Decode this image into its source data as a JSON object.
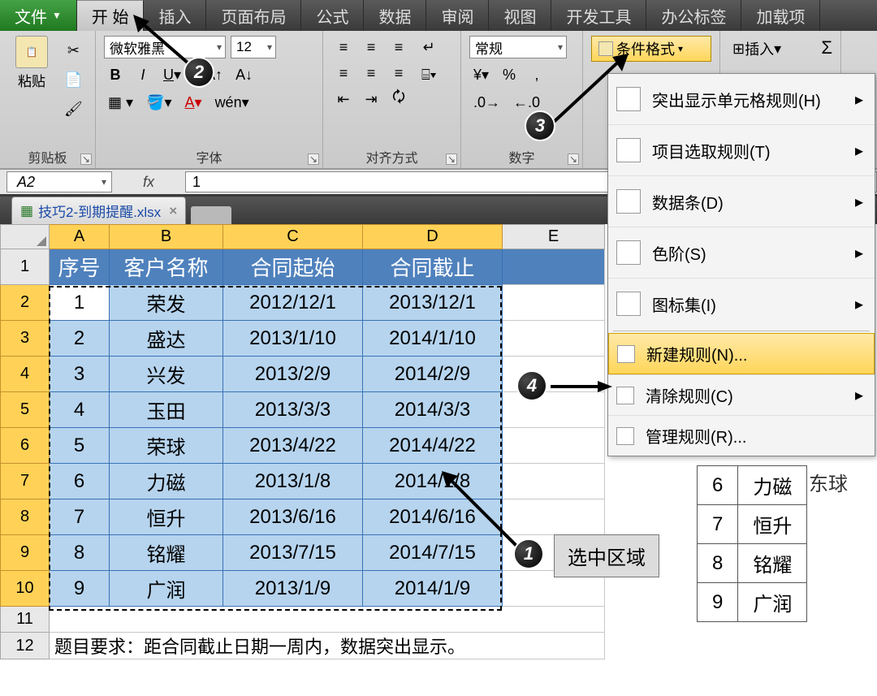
{
  "menu": {
    "file": "文件",
    "tabs": [
      "开 始",
      "插入",
      "页面布局",
      "公式",
      "数据",
      "审阅",
      "视图",
      "开发工具",
      "办公标签",
      "加载项"
    ]
  },
  "ribbon": {
    "clipboard": {
      "paste": "粘贴",
      "label": "剪贴板"
    },
    "font": {
      "name": "微软雅黑",
      "size": "12",
      "label": "字体"
    },
    "align_label": "对齐方式",
    "number": {
      "format": "常规",
      "label": "数字"
    },
    "cf_button": "条件格式",
    "insert_btn": "插入",
    "cf_menu": {
      "highlight": "突出显示单元格规则(H)",
      "top": "项目选取规则(T)",
      "databar": "数据条(D)",
      "colorscale": "色阶(S)",
      "iconset": "图标集(I)",
      "new": "新建规则(N)...",
      "clear": "清除规则(C)",
      "manage": "管理规则(R)..."
    }
  },
  "fx": {
    "namebox": "A2",
    "value": "1"
  },
  "sheet_tab": "技巧2-到期提醒.xlsx",
  "headers": [
    "序号",
    "客户名称",
    "合同起始",
    "合同截止"
  ],
  "rows": [
    {
      "n": "1",
      "name": "荣发",
      "s": "2012/12/1",
      "e": "2013/12/1"
    },
    {
      "n": "2",
      "name": "盛达",
      "s": "2013/1/10",
      "e": "2014/1/10"
    },
    {
      "n": "3",
      "name": "兴发",
      "s": "2013/2/9",
      "e": "2014/2/9"
    },
    {
      "n": "4",
      "name": "玉田",
      "s": "2013/3/3",
      "e": "2014/3/3"
    },
    {
      "n": "5",
      "name": "荣球",
      "s": "2013/4/22",
      "e": "2014/4/22"
    },
    {
      "n": "6",
      "name": "力磁",
      "s": "2013/1/8",
      "e": "2014/1/8"
    },
    {
      "n": "7",
      "name": "恒升",
      "s": "2013/6/16",
      "e": "2014/6/16"
    },
    {
      "n": "8",
      "name": "铭耀",
      "s": "2013/7/15",
      "e": "2014/7/15"
    },
    {
      "n": "9",
      "name": "广润",
      "s": "2013/1/9",
      "e": "2014/1/9"
    }
  ],
  "note": "题目要求：距合同截止日期一周内，数据突出显示。",
  "side_rows": [
    {
      "n": "6",
      "name": "力磁"
    },
    {
      "n": "7",
      "name": "恒升"
    },
    {
      "n": "8",
      "name": "铭耀"
    },
    {
      "n": "9",
      "name": "广润"
    }
  ],
  "side_extra": "东球",
  "annot": {
    "step1": "选中区域"
  }
}
